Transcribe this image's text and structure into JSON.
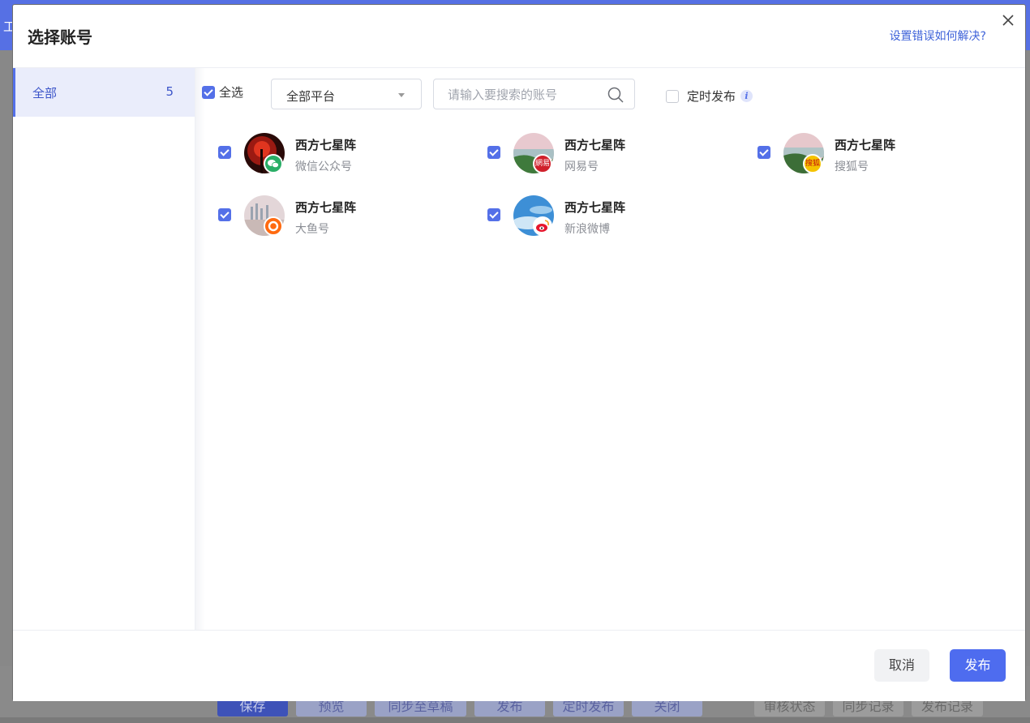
{
  "background": {
    "topbar_glyph": "工",
    "footer_buttons": [
      {
        "label": "保存",
        "style": "primary"
      },
      {
        "label": "预览",
        "style": "light"
      },
      {
        "label": "同步至草稿",
        "style": "light"
      },
      {
        "label": "发布",
        "style": "light"
      },
      {
        "label": "定时发布",
        "style": "light"
      },
      {
        "label": "关闭",
        "style": "light"
      },
      {
        "label": "审核状态",
        "style": "grey"
      },
      {
        "label": "同步记录",
        "style": "grey"
      },
      {
        "label": "发布记录",
        "style": "grey"
      }
    ]
  },
  "modal": {
    "title": "选择账号",
    "help_link": "设置错误如何解决?",
    "close_icon": "close-icon"
  },
  "sidebar": {
    "items": [
      {
        "label": "全部",
        "count": "5",
        "active": true
      }
    ]
  },
  "toolbar": {
    "select_all_label": "全选",
    "select_all_checked": true,
    "platform_select_value": "全部平台",
    "search_placeholder": "请输入要搜索的账号",
    "timed_publish_label": "定时发布",
    "timed_publish_checked": false,
    "info_glyph": "i"
  },
  "accounts": [
    {
      "name": "西方七星阵",
      "platform": "微信公众号",
      "checked": true,
      "badge": "wechat-icon",
      "badge_color": "#2aae67"
    },
    {
      "name": "西方七星阵",
      "platform": "网易号",
      "checked": true,
      "badge": "netease-icon",
      "badge_color": "#d0202b"
    },
    {
      "name": "西方七星阵",
      "platform": "搜狐号",
      "checked": true,
      "badge": "sohu-icon",
      "badge_color": "#f5c300"
    },
    {
      "name": "西方七星阵",
      "platform": "大鱼号",
      "checked": true,
      "badge": "dayu-icon",
      "badge_color": "#ff6a10"
    },
    {
      "name": "西方七星阵",
      "platform": "新浪微博",
      "checked": true,
      "badge": "weibo-icon",
      "badge_color": "#e6162d"
    }
  ],
  "footer": {
    "cancel_label": "取消",
    "publish_label": "发布"
  },
  "colors": {
    "accent": "#4e6cef",
    "link": "#3f63d9"
  }
}
